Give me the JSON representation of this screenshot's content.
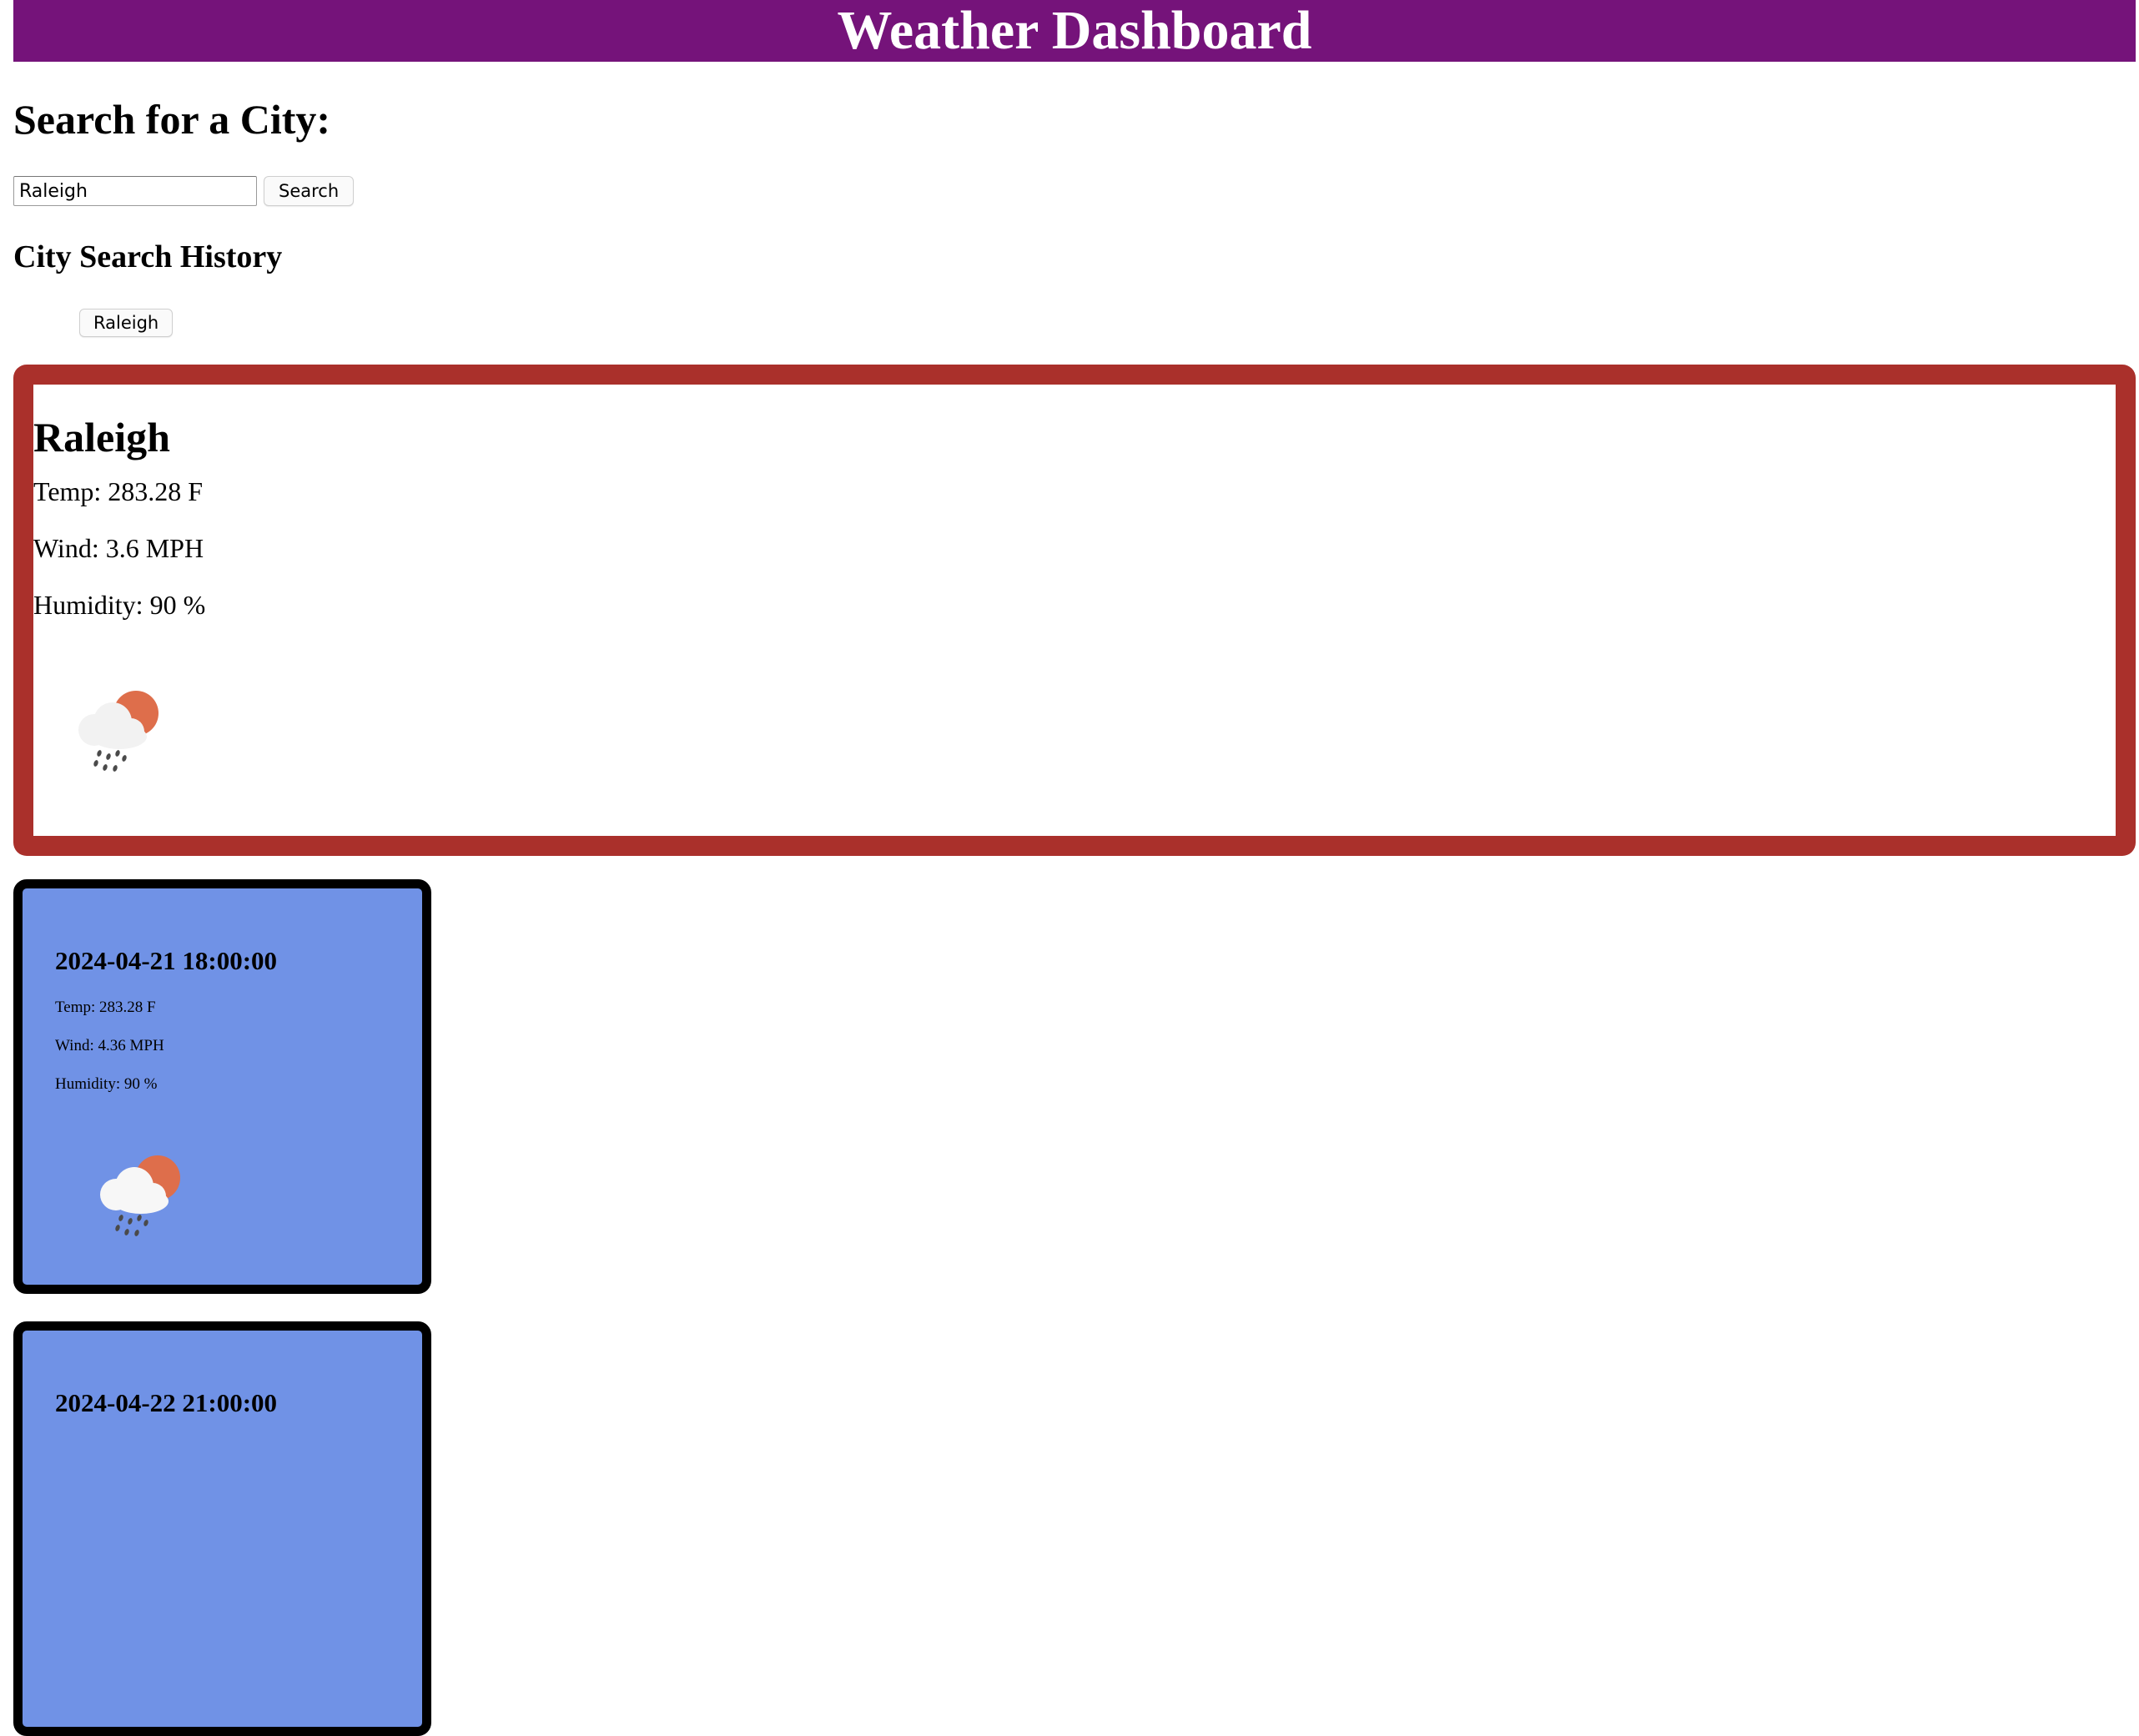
{
  "header": {
    "title": "Weather Dashboard"
  },
  "search": {
    "heading": "Search for a City:",
    "input_value": "Raleigh",
    "button_label": "Search"
  },
  "history": {
    "heading": "City Search History",
    "items": [
      "Raleigh"
    ]
  },
  "current": {
    "city": "Raleigh",
    "temp": "Temp: 283.28 F",
    "wind": "Wind: 3.6 MPH",
    "humidity": "Humidity: 90 %",
    "icon": "rain-sun-cloud-icon"
  },
  "forecast": [
    {
      "date": "2024-04-21 18:00:00",
      "temp": "Temp: 283.28 F",
      "wind": "Wind: 4.36 MPH",
      "humidity": "Humidity: 90 %",
      "icon": "rain-sun-cloud-icon"
    },
    {
      "date": "2024-04-22 21:00:00"
    }
  ],
  "colors": {
    "header_bg": "#75137a",
    "current_border": "#aa302b",
    "card_bg": "#7092e6",
    "card_border": "#000000"
  }
}
